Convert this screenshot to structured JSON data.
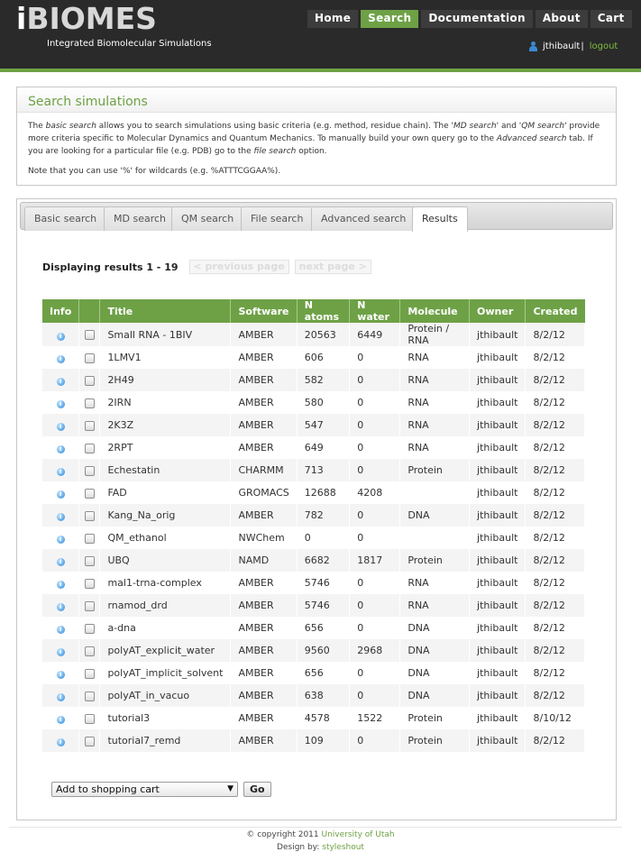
{
  "header": {
    "logo_i": "i",
    "logo_rest": "BIOMES",
    "slogan": "Integrated Biomolecular Simulations",
    "nav": [
      {
        "label": "Home",
        "active": false
      },
      {
        "label": "Search",
        "active": true
      },
      {
        "label": "Documentation",
        "active": false
      },
      {
        "label": "About",
        "active": false
      },
      {
        "label": "Cart",
        "active": false
      }
    ],
    "username": "jthibault",
    "separator": "|",
    "logout": "logout"
  },
  "intro": {
    "title": "Search simulations",
    "p1_a": "The ",
    "p1_basic": "basic search",
    "p1_b": " allows you to search simulations using basic criteria (e.g. method, residue chain). The '",
    "p1_md": "MD search",
    "p1_c": "' and '",
    "p1_qm": "QM search",
    "p1_d": "' provide more criteria specific to Molecular Dynamics and Quantum Mechanics. To manually build your own query go to the ",
    "p1_adv": "Advanced search",
    "p1_e": " tab. If you are looking for a particular file (e.g. PDB) go to the ",
    "p1_file": "file search",
    "p1_f": " option.",
    "p2": "Note that you can use '%' for wildcards (e.g. %ATTTCGGAA%)."
  },
  "tabs": [
    {
      "label": "Basic search",
      "active": false
    },
    {
      "label": "MD search",
      "active": false
    },
    {
      "label": "QM search",
      "active": false
    },
    {
      "label": "File search",
      "active": false
    },
    {
      "label": "Advanced search",
      "active": false
    },
    {
      "label": "Results",
      "active": true
    }
  ],
  "results": {
    "summary": "Displaying results 1 - 19",
    "prev_page": "< previous page",
    "next_page": "next page >"
  },
  "table": {
    "columns": [
      "Info",
      "",
      "Title",
      "Software",
      "N atoms",
      "N water",
      "Molecule",
      "Owner",
      "Created"
    ],
    "rows": [
      {
        "title": "Small RNA - 1BIV",
        "software": "AMBER",
        "atoms": "20563",
        "water": "6449",
        "molecule": "Protein / RNA",
        "owner": "jthibault",
        "created": "8/2/12"
      },
      {
        "title": "1LMV1",
        "software": "AMBER",
        "atoms": "606",
        "water": "0",
        "molecule": "RNA",
        "owner": "jthibault",
        "created": "8/2/12"
      },
      {
        "title": "2H49",
        "software": "AMBER",
        "atoms": "582",
        "water": "0",
        "molecule": "RNA",
        "owner": "jthibault",
        "created": "8/2/12"
      },
      {
        "title": "2IRN",
        "software": "AMBER",
        "atoms": "580",
        "water": "0",
        "molecule": "RNA",
        "owner": "jthibault",
        "created": "8/2/12"
      },
      {
        "title": "2K3Z",
        "software": "AMBER",
        "atoms": "547",
        "water": "0",
        "molecule": "RNA",
        "owner": "jthibault",
        "created": "8/2/12"
      },
      {
        "title": "2RPT",
        "software": "AMBER",
        "atoms": "649",
        "water": "0",
        "molecule": "RNA",
        "owner": "jthibault",
        "created": "8/2/12"
      },
      {
        "title": "Echestatin",
        "software": "CHARMM",
        "atoms": "713",
        "water": "0",
        "molecule": "Protein",
        "owner": "jthibault",
        "created": "8/2/12"
      },
      {
        "title": "FAD",
        "software": "GROMACS",
        "atoms": "12688",
        "water": "4208",
        "molecule": "",
        "owner": "jthibault",
        "created": "8/2/12"
      },
      {
        "title": "Kang_Na_orig",
        "software": "AMBER",
        "atoms": "782",
        "water": "0",
        "molecule": "DNA",
        "owner": "jthibault",
        "created": "8/2/12"
      },
      {
        "title": "QM_ethanol",
        "software": "NWChem",
        "atoms": "0",
        "water": "0",
        "molecule": "",
        "owner": "jthibault",
        "created": "8/2/12"
      },
      {
        "title": "UBQ",
        "software": "NAMD",
        "atoms": "6682",
        "water": "1817",
        "molecule": "Protein",
        "owner": "jthibault",
        "created": "8/2/12"
      },
      {
        "title": "mal1-trna-complex",
        "software": "AMBER",
        "atoms": "5746",
        "water": "0",
        "molecule": "RNA",
        "owner": "jthibault",
        "created": "8/2/12"
      },
      {
        "title": "rnamod_drd",
        "software": "AMBER",
        "atoms": "5746",
        "water": "0",
        "molecule": "RNA",
        "owner": "jthibault",
        "created": "8/2/12"
      },
      {
        "title": "a-dna",
        "software": "AMBER",
        "atoms": "656",
        "water": "0",
        "molecule": "DNA",
        "owner": "jthibault",
        "created": "8/2/12"
      },
      {
        "title": "polyAT_explicit_water",
        "software": "AMBER",
        "atoms": "9560",
        "water": "2968",
        "molecule": "DNA",
        "owner": "jthibault",
        "created": "8/2/12"
      },
      {
        "title": "polyAT_implicit_solvent",
        "software": "AMBER",
        "atoms": "656",
        "water": "0",
        "molecule": "DNA",
        "owner": "jthibault",
        "created": "8/2/12"
      },
      {
        "title": "polyAT_in_vacuo",
        "software": "AMBER",
        "atoms": "638",
        "water": "0",
        "molecule": "DNA",
        "owner": "jthibault",
        "created": "8/2/12"
      },
      {
        "title": "tutorial3",
        "software": "AMBER",
        "atoms": "4578",
        "water": "1522",
        "molecule": "Protein",
        "owner": "jthibault",
        "created": "8/10/12"
      },
      {
        "title": "tutorial7_remd",
        "software": "AMBER",
        "atoms": "109",
        "water": "0",
        "molecule": "Protein",
        "owner": "jthibault",
        "created": "8/2/12"
      }
    ]
  },
  "actions": {
    "select_value": "Add to shopping cart",
    "go_label": "Go"
  },
  "footer": {
    "copyright": "© copyright 2011 ",
    "university": "University of Utah",
    "design_by": "Design by: ",
    "designer": "styleshout"
  },
  "colors": {
    "accent": "#6ea146",
    "header_bg": "#2a2a2a"
  }
}
